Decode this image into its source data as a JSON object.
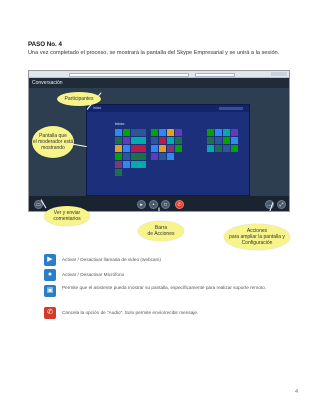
{
  "step": {
    "title": "PASO No. 4",
    "description": "Una vez completado el proceso, se mostrará la pantalla del Skype Empresarial y se unirá a la sesión."
  },
  "screenshot": {
    "conversation_title": "Conversación",
    "desktop_label": "Inicio",
    "start_text": "Inicio"
  },
  "callouts": {
    "participants": "Participantes",
    "moderator_screen": [
      "Pantalla que",
      "el moderador está",
      "mostrando"
    ],
    "chat": [
      "Ver y enviar",
      "comentarios"
    ],
    "actions_bar": [
      "Barra",
      "de Acciones"
    ],
    "actions_config": [
      "Acciones",
      "para ampliar la pantalla y",
      "Configuración"
    ]
  },
  "legend": [
    {
      "icon": "video-camera-icon",
      "text": "Activar / Desactivar llamada de video (webcam)"
    },
    {
      "icon": "microphone-icon",
      "text": "Activar / Desactivar Micrófono"
    },
    {
      "icon": "screen-share-icon",
      "text": "Permite que el asistente pueda mostrar su pantalla, específicamente para realizar soporte remoto."
    },
    {
      "icon": "hang-up-icon",
      "text": "Cancela la opción de “Audio”. Solo permite envío/recibir  mensaje."
    }
  ],
  "colors": {
    "callout": "#f7f48c",
    "legend_icon": "#2a7ec8",
    "hang_up": "#d33a2b",
    "page_number": "#4a7ab8"
  },
  "page_number": "4"
}
